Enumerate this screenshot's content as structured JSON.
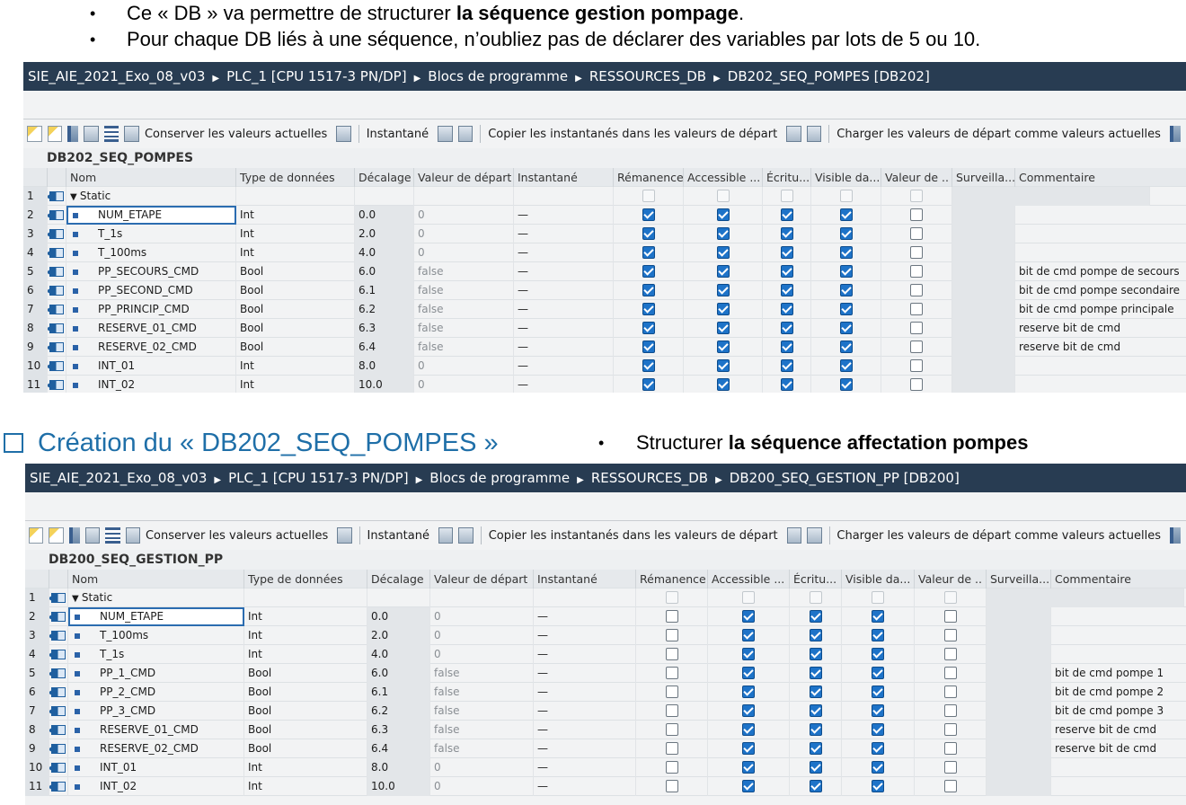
{
  "bullets": [
    {
      "dot": "•",
      "pre": "Ce « DB » va permettre de structurer ",
      "bold": "la séquence gestion pompage",
      "post": "."
    },
    {
      "dot": "•",
      "pre": "Pour chaque DB liés à une séquence, n’oubliez pas de déclarer des variables par lots de 5 ou 10.",
      "bold": "",
      "post": ""
    }
  ],
  "section": {
    "title": "Création du « DB202_SEQ_POMPES »",
    "bullet_dot": "•",
    "bullet_pre": "Structurer ",
    "bullet_bold": "la séquence affectation pompes"
  },
  "toolbar": {
    "conserver": "Conserver les valeurs actuelles",
    "instantane": "Instantané",
    "copier": "Copier les instantanés dans les valeurs de départ",
    "charger": "Charger les valeurs de départ comme valeurs actuelles"
  },
  "headers": [
    "Nom",
    "Type de données",
    "Décalage",
    "Valeur de départ",
    "Instantané",
    "Rémanence",
    "Accessible ...",
    "Écritu...",
    "Visible da...",
    "Valeur de ..",
    "Surveilla...",
    "Commentaire"
  ],
  "panel1": {
    "breadcrumb": [
      "SIE_AIE_2021_Exo_08_v03",
      "PLC_1 [CPU 1517-3 PN/DP]",
      "Blocs de programme",
      "RESSOURCES_DB",
      "DB202_SEQ_POMPES [DB202]"
    ],
    "db_name": "DB202_SEQ_POMPES",
    "static_label": "Static",
    "rows": [
      {
        "n": "2",
        "name": "NUM_ETAPE",
        "type": "Int",
        "offset": "0.0",
        "start": "0",
        "snap": "—",
        "rem": true,
        "comment": ""
      },
      {
        "n": "3",
        "name": "T_1s",
        "type": "Int",
        "offset": "2.0",
        "start": "0",
        "snap": "—",
        "rem": true,
        "comment": ""
      },
      {
        "n": "4",
        "name": "T_100ms",
        "type": "Int",
        "offset": "4.0",
        "start": "0",
        "snap": "—",
        "rem": true,
        "comment": ""
      },
      {
        "n": "5",
        "name": "PP_SECOURS_CMD",
        "type": "Bool",
        "offset": "6.0",
        "start": "false",
        "snap": "—",
        "rem": true,
        "comment": "bit de cmd pompe de secours"
      },
      {
        "n": "6",
        "name": "PP_SECOND_CMD",
        "type": "Bool",
        "offset": "6.1",
        "start": "false",
        "snap": "—",
        "rem": true,
        "comment": "bit de cmd pompe secondaire"
      },
      {
        "n": "7",
        "name": "PP_PRINCIP_CMD",
        "type": "Bool",
        "offset": "6.2",
        "start": "false",
        "snap": "—",
        "rem": true,
        "comment": "bit de cmd pompe principale"
      },
      {
        "n": "8",
        "name": "RESERVE_01_CMD",
        "type": "Bool",
        "offset": "6.3",
        "start": "false",
        "snap": "—",
        "rem": true,
        "comment": "reserve bit de cmd"
      },
      {
        "n": "9",
        "name": "RESERVE_02_CMD",
        "type": "Bool",
        "offset": "6.4",
        "start": "false",
        "snap": "—",
        "rem": true,
        "comment": "reserve bit de cmd"
      },
      {
        "n": "10",
        "name": "INT_01",
        "type": "Int",
        "offset": "8.0",
        "start": "0",
        "snap": "—",
        "rem": true,
        "comment": ""
      },
      {
        "n": "11",
        "name": "INT_02",
        "type": "Int",
        "offset": "10.0",
        "start": "0",
        "snap": "—",
        "rem": true,
        "comment": ""
      }
    ]
  },
  "panel2": {
    "breadcrumb": [
      "SIE_AIE_2021_Exo_08_v03",
      "PLC_1 [CPU 1517-3 PN/DP]",
      "Blocs de programme",
      "RESSOURCES_DB",
      "DB200_SEQ_GESTION_PP [DB200]"
    ],
    "db_name": "DB200_SEQ_GESTION_PP",
    "static_label": "Static",
    "rows": [
      {
        "n": "2",
        "name": "NUM_ETAPE",
        "type": "Int",
        "offset": "0.0",
        "start": "0",
        "snap": "—",
        "rem": false,
        "comment": ""
      },
      {
        "n": "3",
        "name": "T_100ms",
        "type": "Int",
        "offset": "2.0",
        "start": "0",
        "snap": "—",
        "rem": false,
        "comment": ""
      },
      {
        "n": "4",
        "name": "T_1s",
        "type": "Int",
        "offset": "4.0",
        "start": "0",
        "snap": "—",
        "rem": false,
        "comment": ""
      },
      {
        "n": "5",
        "name": "PP_1_CMD",
        "type": "Bool",
        "offset": "6.0",
        "start": "false",
        "snap": "—",
        "rem": false,
        "comment": "bit de cmd pompe 1"
      },
      {
        "n": "6",
        "name": "PP_2_CMD",
        "type": "Bool",
        "offset": "6.1",
        "start": "false",
        "snap": "—",
        "rem": false,
        "comment": "bit de cmd pompe 2"
      },
      {
        "n": "7",
        "name": "PP_3_CMD",
        "type": "Bool",
        "offset": "6.2",
        "start": "false",
        "snap": "—",
        "rem": false,
        "comment": "bit de cmd pompe 3"
      },
      {
        "n": "8",
        "name": "RESERVE_01_CMD",
        "type": "Bool",
        "offset": "6.3",
        "start": "false",
        "snap": "—",
        "rem": false,
        "comment": "reserve bit de cmd"
      },
      {
        "n": "9",
        "name": "RESERVE_02_CMD",
        "type": "Bool",
        "offset": "6.4",
        "start": "false",
        "snap": "—",
        "rem": false,
        "comment": "reserve bit de cmd"
      },
      {
        "n": "10",
        "name": "INT_01",
        "type": "Int",
        "offset": "8.0",
        "start": "0",
        "snap": "—",
        "rem": false,
        "comment": ""
      },
      {
        "n": "11",
        "name": "INT_02",
        "type": "Int",
        "offset": "10.0",
        "start": "0",
        "snap": "—",
        "rem": false,
        "comment": ""
      }
    ]
  },
  "colors": {
    "accent": "#1f6fa8",
    "titlebar": "#283c52",
    "checkbox_on": "#1e73c8"
  },
  "icons": [
    "db-row-icon",
    "variable-icon",
    "expand-triangle-icon",
    "type-picker-icon"
  ]
}
